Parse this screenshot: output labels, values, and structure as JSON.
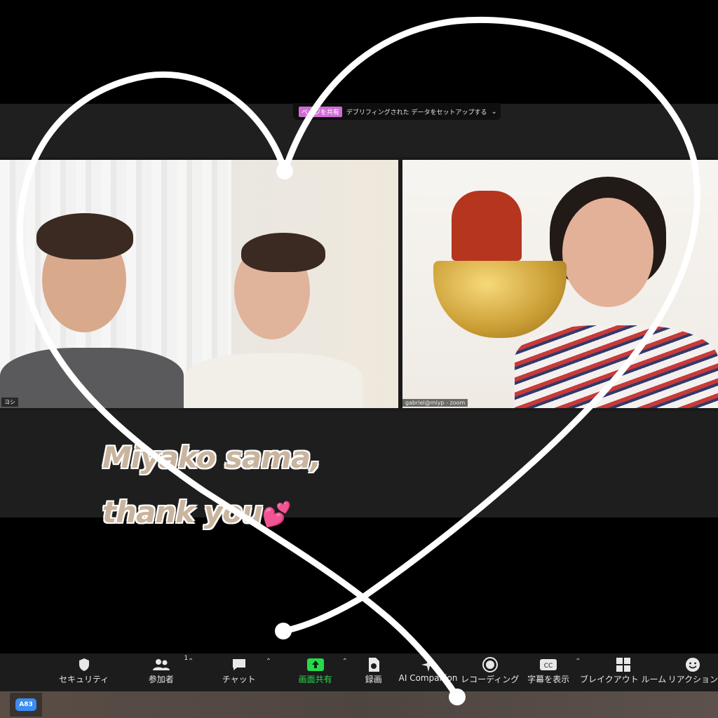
{
  "share_banner": {
    "tag": "ページを共有",
    "text": "デブリフィングされた データをセットアップする"
  },
  "tiles": {
    "left_name": "ヨシ",
    "right_name": "gabriel@miyp - zoom"
  },
  "caption": {
    "line1": "Miyako sama,",
    "line2": "thank you",
    "emoji": "💕"
  },
  "toolbar": {
    "items": [
      {
        "label": "セキュリティ",
        "icon": "shield-icon"
      },
      {
        "label": "参加者",
        "icon": "participants-icon",
        "count": "1"
      },
      {
        "label": "チャット",
        "icon": "chat-icon"
      },
      {
        "label": "画面共有",
        "icon": "share-screen-icon"
      },
      {
        "label": "録画",
        "icon": "record-icon"
      },
      {
        "label": "AI Companion",
        "icon": "ai-companion-icon"
      },
      {
        "label": "レコーディング",
        "icon": "recording-icon"
      },
      {
        "label": "字幕を表示",
        "icon": "captions-icon"
      },
      {
        "label": "ブレイクアウト ルーム",
        "icon": "breakout-rooms-icon"
      },
      {
        "label": "リアクション",
        "icon": "reactions-icon"
      }
    ]
  },
  "taskbar": {
    "app_chip": "A83"
  },
  "colors": {
    "accent_green": "#26d94b",
    "toolbar_bg": "#1c1c1c",
    "caption": "#c9b49d"
  }
}
